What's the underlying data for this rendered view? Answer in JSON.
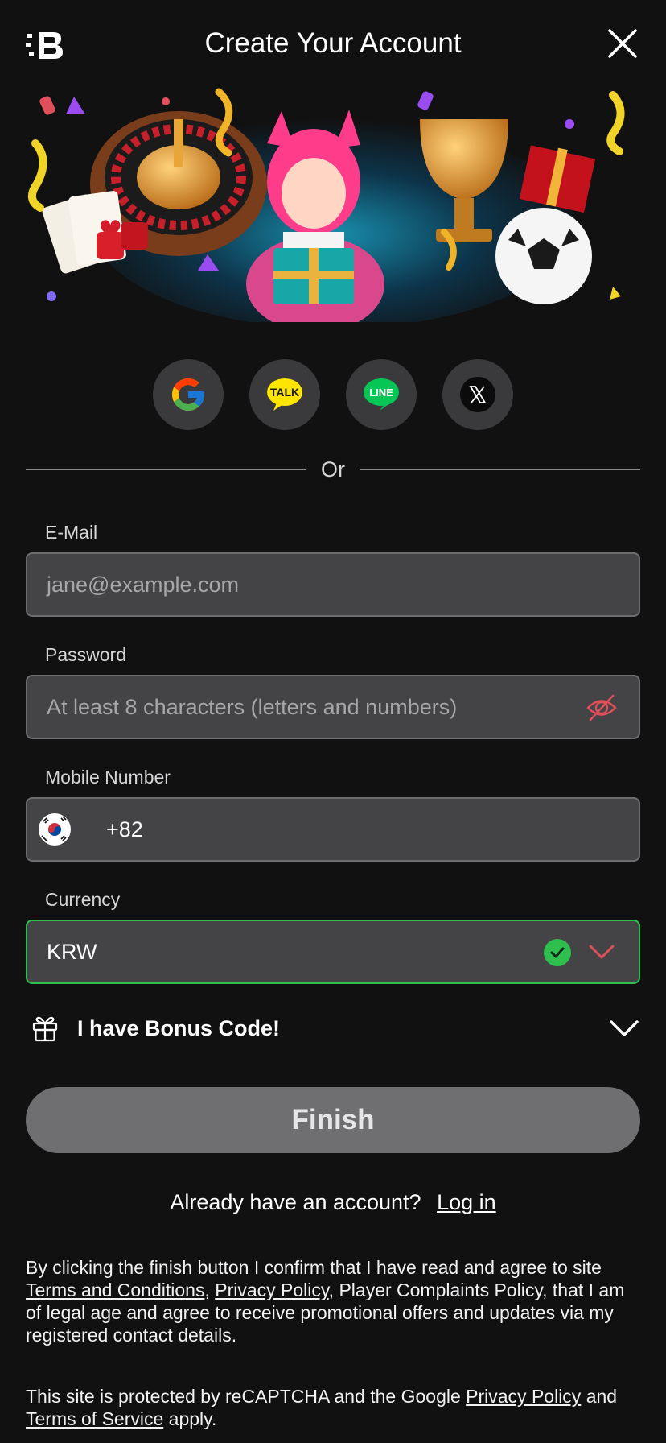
{
  "header": {
    "title": "Create Your Account",
    "logo_icon": "brand-logo-icon",
    "close_icon": "close-icon"
  },
  "social": {
    "providers": [
      {
        "name": "Google",
        "icon": "google-icon"
      },
      {
        "name": "Kakao",
        "icon": "kakaotalk-icon",
        "text": "TALK"
      },
      {
        "name": "LINE",
        "icon": "line-icon",
        "text": "LINE"
      },
      {
        "name": "X",
        "icon": "x-icon"
      }
    ]
  },
  "divider": {
    "text": "Or"
  },
  "form": {
    "email": {
      "label": "E-Mail",
      "placeholder": "jane@example.com"
    },
    "password": {
      "label": "Password",
      "placeholder": "At least 8 characters (letters and numbers)",
      "toggle_icon": "eye-off-icon"
    },
    "mobile": {
      "label": "Mobile Number",
      "prefix": "+82",
      "flag_icon": "south-korea-flag-icon"
    },
    "currency": {
      "label": "Currency",
      "value": "KRW",
      "status_icon": "check-circle-icon",
      "dropdown_icon": "chevron-down-icon"
    }
  },
  "bonus": {
    "label": "I have Bonus Code!",
    "icon": "gift-icon",
    "expand_icon": "chevron-down-icon"
  },
  "finish": {
    "label": "Finish"
  },
  "login": {
    "prompt": "Already have an account?",
    "link": "Log in"
  },
  "legal": {
    "consent_1": "By clicking the finish button I confirm that I have read and agree to site ",
    "terms_link": "Terms and Conditions",
    "sep": ", ",
    "privacy_link": "Privacy Policy",
    "consent_2": ", Player Complaints Policy, that I am of legal age and agree to receive promotional offers and updates via my registered contact details.",
    "recaptcha_1": "This site is protected by reCAPTCHA and the Google ",
    "recaptcha_privacy": "Privacy Policy",
    "recaptcha_and": " and ",
    "recaptcha_terms": "Terms of Service",
    "recaptcha_2": " apply."
  },
  "colors": {
    "background": "#111112",
    "field_bg": "#444446",
    "field_border": "#6d6d70",
    "success": "#2fbf4f",
    "accent_red": "#e0505a",
    "button_disabled": "#6f6f71"
  }
}
